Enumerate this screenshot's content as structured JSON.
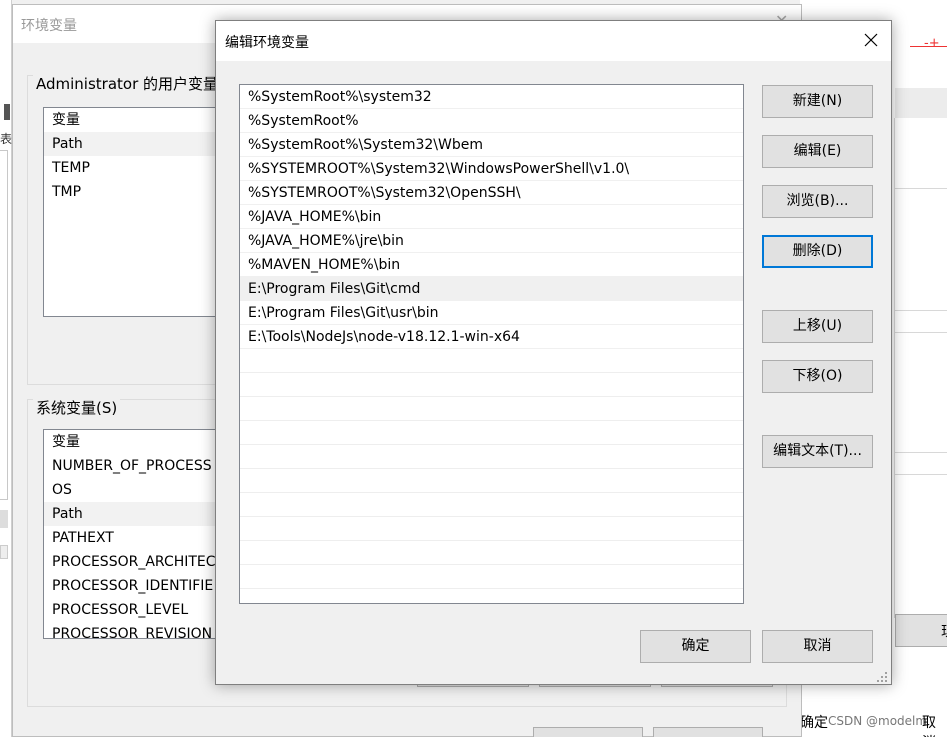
{
  "env_window": {
    "title": "环境变量",
    "user_group_label": "Administrator 的用户变量",
    "user_list": {
      "header": "变量",
      "rows": [
        "Path",
        "TEMP",
        "TMP"
      ],
      "selected": "Path"
    },
    "system_group_label": "系统变量(S)",
    "system_list": {
      "header": "变量",
      "rows": [
        "NUMBER_OF_PROCESS",
        "OS",
        "Path",
        "PATHEXT",
        "PROCESSOR_ARCHITEC",
        "PROCESSOR_IDENTIFIE",
        "PROCESSOR_LEVEL",
        "PROCESSOR_REVISION"
      ],
      "selected": "Path"
    }
  },
  "background_right": {
    "ok_label": "确定",
    "cancel_label": "取消",
    "side_button_label": "现"
  },
  "watermark": "CSDN @modelm",
  "edit_dialog": {
    "title": "编辑环境变量",
    "paths": [
      "%SystemRoot%\\system32",
      "%SystemRoot%",
      "%SystemRoot%\\System32\\Wbem",
      "%SYSTEMROOT%\\System32\\WindowsPowerShell\\v1.0\\",
      "%SYSTEMROOT%\\System32\\OpenSSH\\",
      "%JAVA_HOME%\\bin",
      "%JAVA_HOME%\\jre\\bin",
      "%MAVEN_HOME%\\bin",
      "E:\\Program Files\\Git\\cmd",
      "E:\\Program Files\\Git\\usr\\bin",
      "E:\\Tools\\NodeJs\\node-v18.12.1-win-x64"
    ],
    "selected_index": 8,
    "empty_rows": 10,
    "buttons": {
      "new": "新建(N)",
      "edit": "编辑(E)",
      "browse": "浏览(B)...",
      "delete": "删除(D)",
      "move_up": "上移(U)",
      "move_down": "下移(O)",
      "edit_text": "编辑文本(T)...",
      "ok": "确定",
      "cancel": "取消"
    },
    "focused_button": "delete"
  },
  "colors": {
    "focus_border": "#0078d7",
    "button_bg": "#e1e1e1",
    "dialog_bg": "#f0f0f0"
  }
}
